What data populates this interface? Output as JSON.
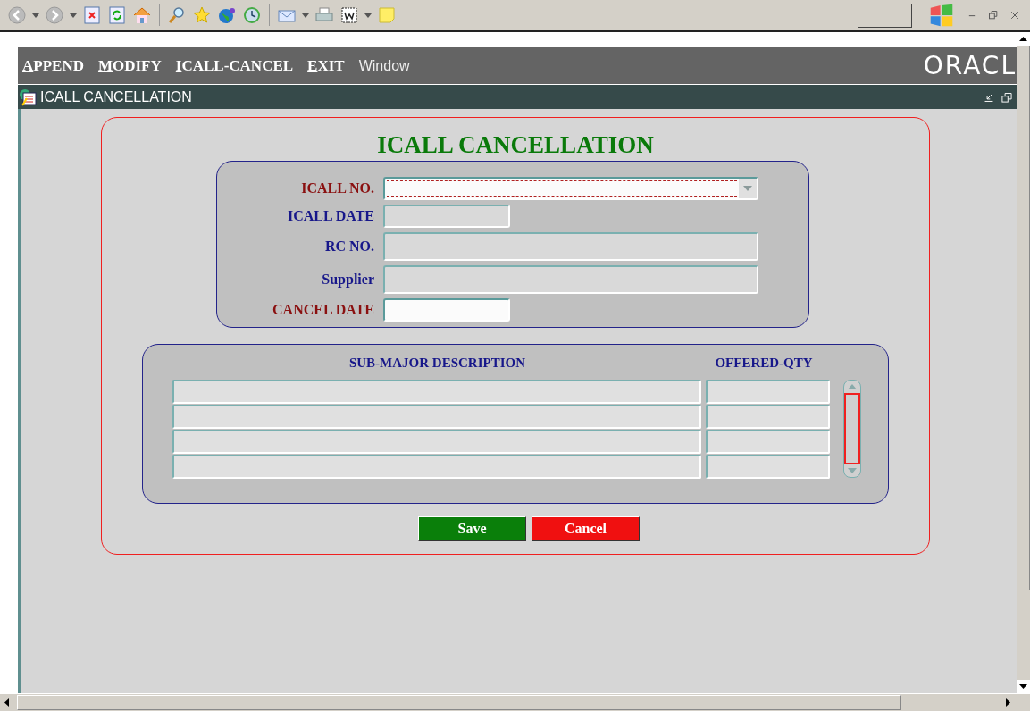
{
  "menu": [
    {
      "label": "APPEND",
      "kind": "form"
    },
    {
      "label": "MODIFY",
      "kind": "form"
    },
    {
      "label": "ICALL-CANCEL",
      "kind": "form"
    },
    {
      "label": "EXIT",
      "kind": "form"
    },
    {
      "label": "Window",
      "kind": "window"
    }
  ],
  "logo": "ORACL",
  "window": {
    "title": "ICALL CANCELLATION"
  },
  "form": {
    "title": "ICALL CANCELLATION",
    "fields": [
      {
        "label": "ICALL NO.",
        "required": true,
        "kind": "dropdown",
        "editable": true,
        "focused": true
      },
      {
        "label": "ICALL DATE",
        "required": false,
        "kind": "short",
        "editable": false,
        "focused": false
      },
      {
        "label": "RC NO.",
        "required": false,
        "kind": "long",
        "editable": false,
        "focused": false
      },
      {
        "label": "Supplier",
        "required": false,
        "kind": "long",
        "editable": false,
        "focused": false
      },
      {
        "label": "CANCEL DATE",
        "required": true,
        "kind": "short",
        "editable": true,
        "focused": false
      }
    ],
    "table": {
      "columns": [
        "SUB-MAJOR DESCRIPTION",
        "OFFERED-QTY"
      ]
    },
    "buttons": [
      {
        "label": "Save",
        "kind": "save"
      },
      {
        "label": "Cancel",
        "kind": "cancel"
      }
    ]
  }
}
